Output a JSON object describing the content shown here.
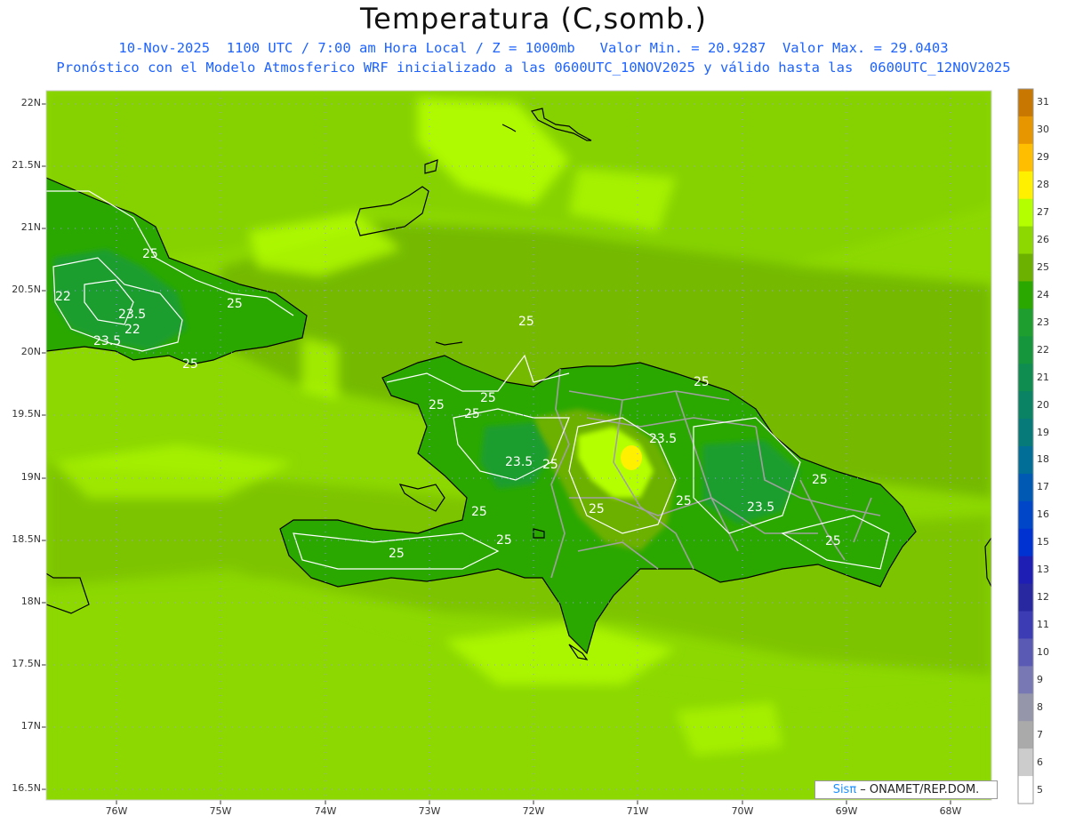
{
  "title": "Temperatura (C,somb.)",
  "subtitle_line1": "10-Nov-2025  1100 UTC / 7:00 am Hora Local / Z = 1000mb   Valor Min. = 20.9287  Valor Max. = 29.0403",
  "subtitle_line2": "Pronóstico con el Modelo Atmosferico WRF inicializado a las 0600UTC_10NOV2025 y válido hasta las  0600UTC_12NOV2025",
  "credit": {
    "brand": "Sisπ",
    "text": " – ONAMET/REP.DOM."
  },
  "lat_labels": [
    "22N",
    "21.5N",
    "21N",
    "20.5N",
    "20N",
    "19.5N",
    "19N",
    "18.5N",
    "18N",
    "17.5N",
    "17N",
    "16.5N"
  ],
  "lon_labels": [
    "76W",
    "75W",
    "74W",
    "73W",
    "72W",
    "71W",
    "70W",
    "69W",
    "68W"
  ],
  "colorbar": {
    "labels": [
      "31",
      "30",
      "29",
      "28",
      "27",
      "26",
      "25",
      "24",
      "23",
      "22",
      "21",
      "20",
      "19",
      "18",
      "17",
      "16",
      "15",
      "13",
      "12",
      "11",
      "10",
      "9",
      "8",
      "7",
      "6",
      "5"
    ],
    "colors": [
      "#c87800",
      "#e89600",
      "#ffbe00",
      "#fff000",
      "#b4ff00",
      "#8cd800",
      "#6cb000",
      "#2aa800",
      "#1e9e2e",
      "#16963c",
      "#0f8c50",
      "#0a8264",
      "#057a78",
      "#006e96",
      "#005ab4",
      "#0046c8",
      "#0032d2",
      "#1e1eb4",
      "#2828a0",
      "#3c3cb4",
      "#5a5ab4",
      "#7878b4",
      "#9696aa",
      "#aaaaaa",
      "#cccccc",
      "#ffffff"
    ]
  },
  "contour_labels": [
    "25",
    "22",
    "23.5",
    "22",
    "23.5",
    "25",
    "25",
    "25",
    "25",
    "25",
    "25",
    "25",
    "23.5",
    "23.5",
    "25",
    "25",
    "25",
    "25",
    "25",
    "23.5",
    "25",
    "25"
  ]
}
